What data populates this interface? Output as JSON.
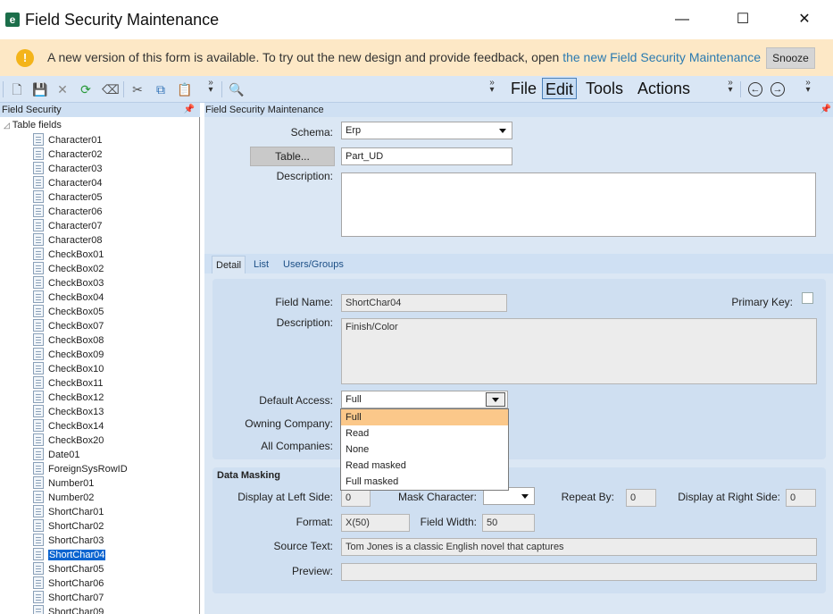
{
  "window": {
    "icon_letter": "e",
    "title": "Field Security Maintenance",
    "min": "—",
    "max": "☐",
    "close": "✕"
  },
  "banner": {
    "icon": "!",
    "text": "A new version of this form is available. To try out the new design and provide feedback, open ",
    "link": "the new Field Security Maintenance",
    "snooze": "Snooze"
  },
  "toolbar": {
    "menus": {
      "file": "File",
      "edit": "Edit",
      "tools": "Tools",
      "actions": "Actions"
    }
  },
  "left_panel": {
    "header": "Field Security",
    "root": "Table fields",
    "items": [
      "Character01",
      "Character02",
      "Character03",
      "Character04",
      "Character05",
      "Character06",
      "Character07",
      "Character08",
      "CheckBox01",
      "CheckBox02",
      "CheckBox03",
      "CheckBox04",
      "CheckBox05",
      "CheckBox07",
      "CheckBox08",
      "CheckBox09",
      "CheckBox10",
      "CheckBox11",
      "CheckBox12",
      "CheckBox13",
      "CheckBox14",
      "CheckBox20",
      "Date01",
      "ForeignSysRowID",
      "Number01",
      "Number02",
      "ShortChar01",
      "ShortChar02",
      "ShortChar03",
      "ShortChar04",
      "ShortChar05",
      "ShortChar06",
      "ShortChar07",
      "ShortChar09"
    ],
    "selected": "ShortChar04"
  },
  "main": {
    "header": "Field Security Maintenance",
    "schema_label": "Schema:",
    "schema_value": "Erp",
    "table_button": "Table...",
    "table_value": "Part_UD",
    "description_label": "Description:",
    "description_value": "",
    "tabs": [
      "Detail",
      "List",
      "Users/Groups"
    ],
    "detail": {
      "field_name_label": "Field Name:",
      "field_name_value": "ShortChar04",
      "primary_key_label": "Primary Key:",
      "description_label": "Description:",
      "description_value": "Finish/Color",
      "default_access_label": "Default Access:",
      "default_access_value": "Full",
      "owning_company_label": "Owning Company:",
      "all_companies_label": "All Companies:",
      "access_options": [
        "Full",
        "Read",
        "None",
        "Read masked",
        "Full masked"
      ]
    },
    "masking": {
      "title": "Data Masking",
      "left_side_label": "Display at Left Side:",
      "left_side_value": "0",
      "mask_char_label": "Mask Character:",
      "mask_char_value": "",
      "repeat_label": "Repeat By:",
      "repeat_value": "0",
      "right_side_label": "Display at Right Side:",
      "right_side_value": "0",
      "format_label": "Format:",
      "format_value": "X(50)",
      "width_label": "Field Width:",
      "width_value": "50",
      "source_label": "Source Text:",
      "source_value": "Tom Jones is a classic English novel that captures",
      "preview_label": "Preview:",
      "preview_value": ""
    }
  }
}
